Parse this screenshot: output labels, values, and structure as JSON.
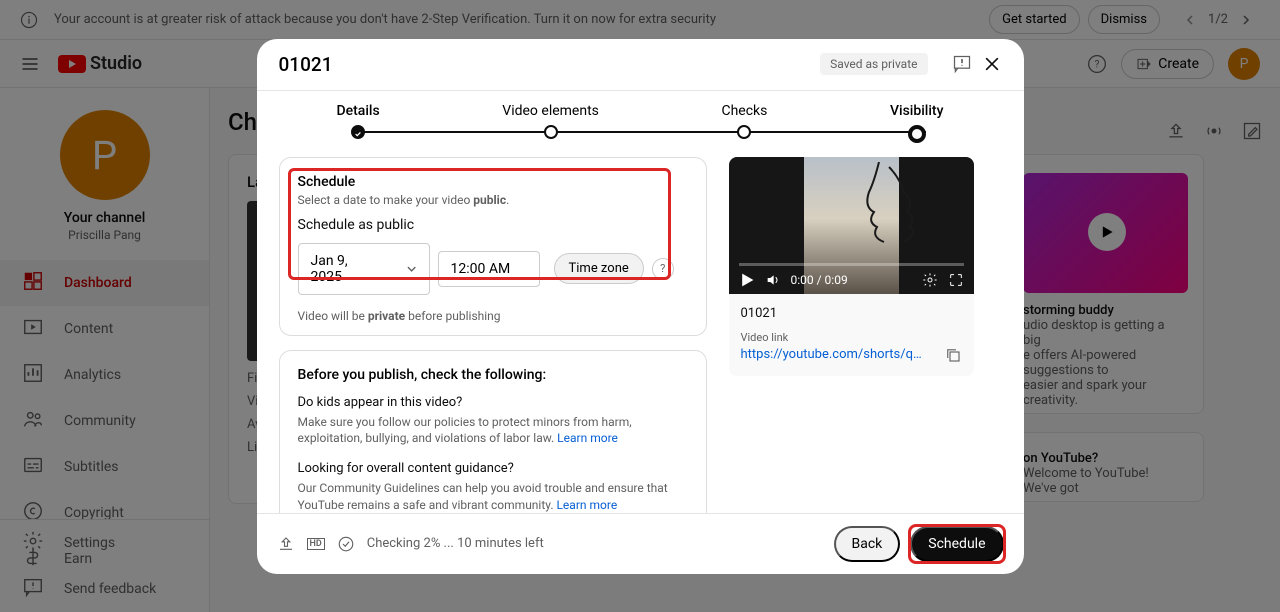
{
  "banner": {
    "text": "Your account is at greater risk of attack because you don't have 2-Step Verification. Turn it on now for extra security",
    "get_started": "Get started",
    "dismiss": "Dismiss",
    "counter": "1/2"
  },
  "logo": {
    "text": "Studio"
  },
  "header": {
    "create": "Create",
    "avatar_letter": "P"
  },
  "sidebar": {
    "avatar_letter": "P",
    "your_channel": "Your channel",
    "user_name": "Priscilla Pang",
    "items": [
      {
        "label": "Dashboard"
      },
      {
        "label": "Content"
      },
      {
        "label": "Analytics"
      },
      {
        "label": "Community"
      },
      {
        "label": "Subtitles"
      },
      {
        "label": "Copyright"
      },
      {
        "label": "Earn"
      }
    ],
    "settings": "Settings",
    "feedback": "Send feedback"
  },
  "main": {
    "title": "Cha",
    "latest": "La",
    "fi": "Fi",
    "vi": "Vi",
    "av": "Av",
    "lik": "Lik",
    "buddy_title": "storming buddy",
    "buddy_l1": "udio desktop is getting a big",
    "buddy_l2": "e offers AI-powered suggestions to",
    "buddy_l3": "easier and spark your creativity.",
    "started_title": "on YouTube?",
    "started_l1": "Welcome to YouTube! We've got"
  },
  "dialog": {
    "title": "01021",
    "saved": "Saved as private",
    "steps": [
      "Details",
      "Video elements",
      "Checks",
      "Visibility"
    ],
    "schedule": {
      "title": "Schedule",
      "desc_a": "Select a date to make your video ",
      "desc_b": "public",
      "desc_c": ".",
      "sub": "Schedule as public",
      "date": "Jan 9, 2025",
      "time": "12:00 AM",
      "tz": "Time zone",
      "help": "?",
      "note_a": "Video will be ",
      "note_b": "private",
      "note_c": " before publishing"
    },
    "publish_check": {
      "title": "Before you publish, check the following:",
      "q1": "Do kids appear in this video?",
      "d1": "Make sure you follow our policies to protect minors from harm, exploitation, bullying, and violations of labor law. ",
      "q2": "Looking for overall content guidance?",
      "d2": "Our Community Guidelines can help you avoid trouble and ensure that YouTube remains a safe and vibrant community. ",
      "learn": "Learn more"
    },
    "video": {
      "time": "0:00 / 0:09",
      "title": "01021",
      "link_label": "Video link",
      "link": "https://youtube.com/shorts/qU..."
    },
    "footer": {
      "hd": "HD",
      "status": "Checking 2% ... 10 minutes left",
      "back": "Back",
      "schedule": "Schedule"
    }
  }
}
